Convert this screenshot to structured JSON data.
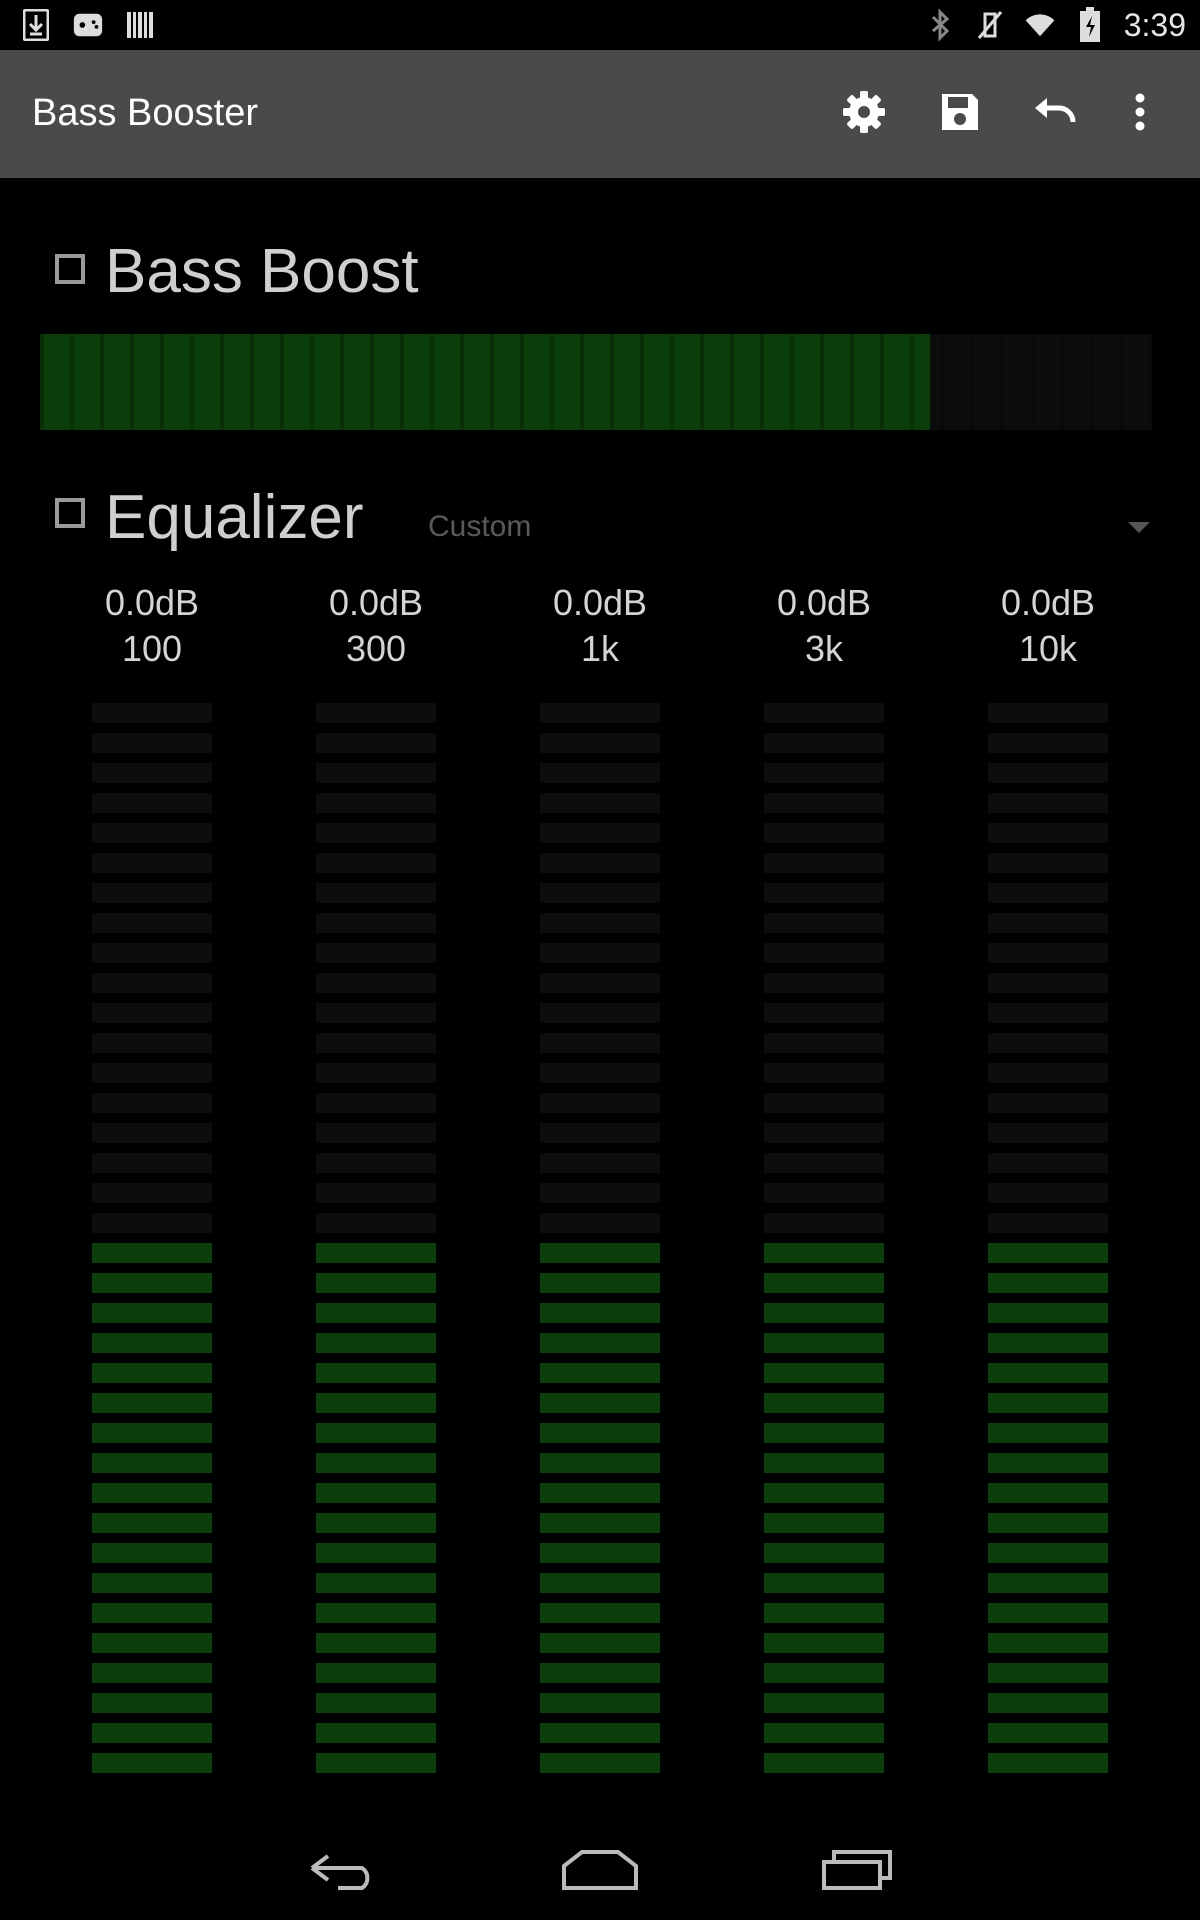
{
  "status_bar": {
    "time": "3:39",
    "left_icons": [
      "download-icon",
      "game-controller-icon",
      "barcode-icon"
    ],
    "right_icons": [
      "bluetooth-icon",
      "vibrate-off-icon",
      "wifi-icon",
      "battery-charging-icon"
    ]
  },
  "app_bar": {
    "title": "Bass Booster",
    "actions": [
      "settings-icon",
      "save-icon",
      "undo-icon",
      "overflow-menu-icon"
    ]
  },
  "bass_boost": {
    "label": "Bass Boost",
    "checked": false,
    "level_fraction": 0.8
  },
  "equalizer": {
    "label": "Equalizer",
    "checked": false,
    "preset": "Custom",
    "segment_count": 36,
    "active_segments": 18,
    "bands": [
      {
        "db": "0.0dB",
        "freq": "100"
      },
      {
        "db": "0.0dB",
        "freq": "300"
      },
      {
        "db": "0.0dB",
        "freq": "1k"
      },
      {
        "db": "0.0dB",
        "freq": "3k"
      },
      {
        "db": "0.0dB",
        "freq": "10k"
      }
    ]
  },
  "colors": {
    "accent_green": "#0b3e0b",
    "segment_off": "#0d0d0d",
    "appbar": "#4a4a4a"
  },
  "nav_bar": [
    "back-icon",
    "home-icon",
    "recents-icon"
  ]
}
